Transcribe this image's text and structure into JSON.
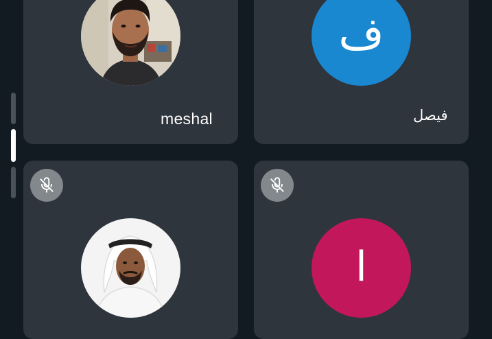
{
  "participants": [
    {
      "name": "meshal",
      "avatar": "photo",
      "muted": false
    },
    {
      "name": "فيصل",
      "avatar": "initial",
      "initial": "ف",
      "color": "#1a88d0",
      "muted": false
    },
    {
      "name": "",
      "avatar": "photo",
      "muted": true
    },
    {
      "name": "",
      "avatar": "initial",
      "initial": "ا",
      "color": "#c2185b",
      "muted": true
    }
  ],
  "icons": {
    "mute": "mic-off-icon"
  },
  "colors": {
    "background": "#121a22",
    "tile": "#2f353d",
    "indicator_active": "#ffffff",
    "indicator_inactive": "#4b5158"
  },
  "page_indicator": {
    "pages": 3,
    "active": 2
  }
}
